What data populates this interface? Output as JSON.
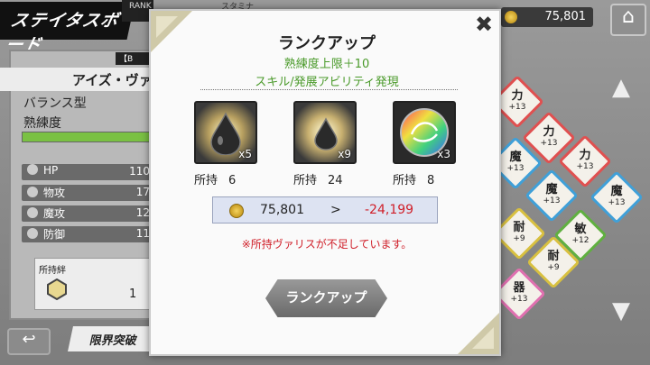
{
  "background": {
    "banner_title": "ステイタスボード",
    "rank_label": "RANK",
    "stamina_label": "スタミナ",
    "character_tag": "【B",
    "character_name": "アイズ・ヴァ",
    "type_label": "バランス型",
    "proficiency_label": "熟練度",
    "stats": [
      {
        "label": "HP",
        "value": "110"
      },
      {
        "label": "物攻",
        "value": "17"
      },
      {
        "label": "魔攻",
        "value": "12"
      },
      {
        "label": "防御",
        "value": "11"
      }
    ],
    "bond_label": "所持絆",
    "bond_count": "1",
    "limit_break_label": "限界突破",
    "money": "75,801",
    "home_icon": "home-icon",
    "tiles": [
      {
        "label": "力",
        "value": "+13",
        "color": "#e05050"
      },
      {
        "label": "力",
        "value": "+13",
        "color": "#e05050"
      },
      {
        "label": "力",
        "value": "+13",
        "color": "#e05050"
      },
      {
        "label": "魔",
        "value": "+13",
        "color": "#40a0d8"
      },
      {
        "label": "魔",
        "value": "+13",
        "color": "#40a0d8"
      },
      {
        "label": "魔",
        "value": "+13",
        "color": "#40a0d8"
      },
      {
        "label": "耐",
        "value": "+9",
        "color": "#d8c040"
      },
      {
        "label": "敏",
        "value": "+12",
        "color": "#60b040"
      },
      {
        "label": "耐",
        "value": "+9",
        "color": "#d8c040"
      },
      {
        "label": "器",
        "value": "+13",
        "color": "#e070b0"
      }
    ]
  },
  "modal": {
    "title": "ランクアップ",
    "effect_1": "熟練度上限＋10",
    "effect_2": "スキル/発展アビリティ発現",
    "close_icon": "close-icon",
    "materials": [
      {
        "icon": "dark-drop-large-icon",
        "required": "x5",
        "owned_label": "所持",
        "owned": "6"
      },
      {
        "icon": "dark-drop-small-icon",
        "required": "x9",
        "owned_label": "所持",
        "owned": "24"
      },
      {
        "icon": "rainbow-orb-icon",
        "required": "x3",
        "owned_label": "所持",
        "owned": "8"
      }
    ],
    "cost": {
      "current": "75,801",
      "arrow": ">",
      "after": "-24,199"
    },
    "warning": "※所持ヴァリスが不足しています。",
    "rank_up_button": "ランクアップ",
    "colors": {
      "effect": "#4a9a2a",
      "warning": "#d0202a"
    }
  }
}
